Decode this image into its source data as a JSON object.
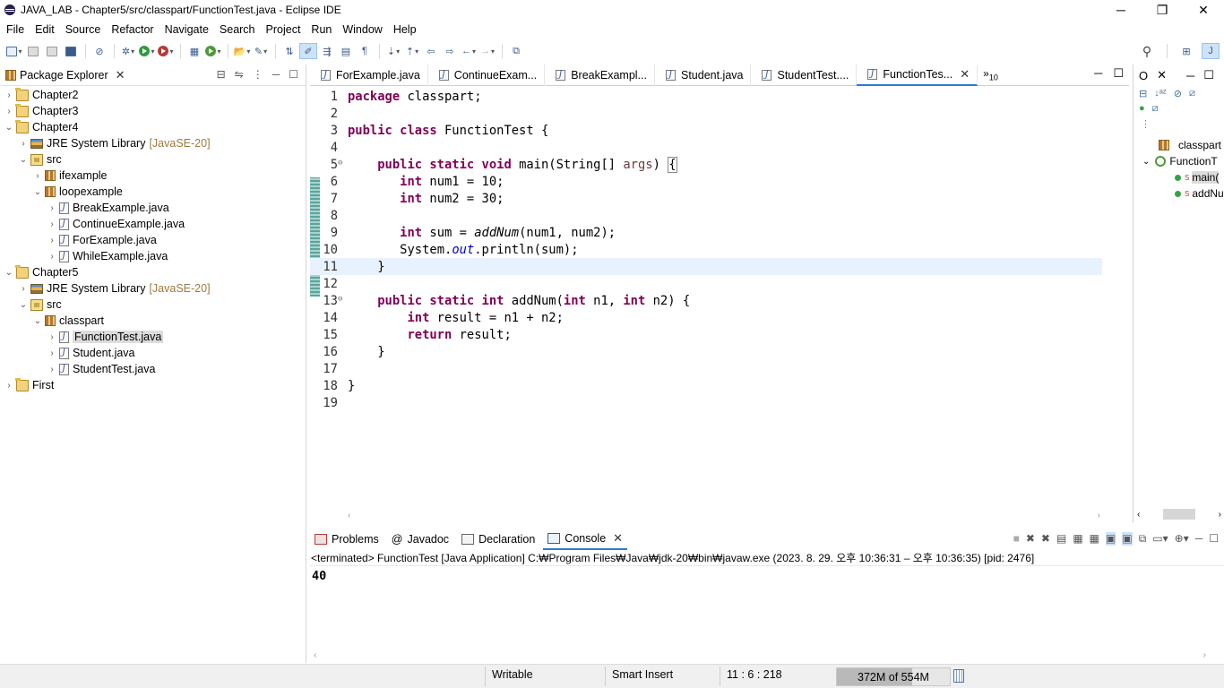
{
  "window": {
    "title": "JAVA_LAB - Chapter5/src/classpart/FunctionTest.java - Eclipse IDE",
    "minimize": "─",
    "restore": "❐",
    "close": "✕"
  },
  "menu": [
    "File",
    "Edit",
    "Source",
    "Refactor",
    "Navigate",
    "Search",
    "Project",
    "Run",
    "Window",
    "Help"
  ],
  "package_explorer": {
    "title": "Package Explorer",
    "tree": {
      "chapter2": "Chapter2",
      "chapter3": "Chapter3",
      "chapter4": "Chapter4",
      "ch4_jre": "JRE System Library",
      "ch4_jre_ver": "[JavaSE-20]",
      "ch4_src": "src",
      "ifexample": "ifexample",
      "loopexample": "loopexample",
      "break": "BreakExample.java",
      "continue": "ContinueExample.java",
      "for": "ForExample.java",
      "while": "WhileExample.java",
      "chapter5": "Chapter5",
      "ch5_jre": "JRE System Library",
      "ch5_jre_ver": "[JavaSE-20]",
      "ch5_src": "src",
      "classpart": "classpart",
      "functiontest": "FunctionTest.java",
      "student": "Student.java",
      "studenttest": "StudentTest.java",
      "first": "First"
    }
  },
  "editor": {
    "tabs": [
      "ForExample.java",
      "ContinueExam...",
      "BreakExampl...",
      "Student.java",
      "StudentTest....",
      "FunctionTes..."
    ],
    "more_tabs": "»",
    "more_count": "10",
    "line_numbers": [
      "1",
      "2",
      "3",
      "4",
      "5",
      "6",
      "7",
      "8",
      "9",
      "10",
      "11",
      "12",
      "13",
      "14",
      "15",
      "16",
      "17",
      "18",
      "19"
    ],
    "fold5": "⊖",
    "fold13": "⊖",
    "code": {
      "l1_kw": "package",
      "l1_rest": " classpart;",
      "l3_kw": "public class",
      "l3_rest": " FunctionTest {",
      "l5_indent": "    ",
      "l5_kw": "public static void",
      "l5_a": " main(String[] ",
      "l5_var": "args",
      "l5_b": ") ",
      "l5_brace": "{",
      "l6_indent": "       ",
      "l6_kw": "int",
      "l6_rest": " num1 = 10;",
      "l7_indent": "       ",
      "l7_kw": "int",
      "l7_rest": " num2 = 30;",
      "l9_indent": "       ",
      "l9_kw": "int",
      "l9_a": " sum = ",
      "l9_m": "addNum",
      "l9_b": "(num1, num2);",
      "l10_indent": "       ",
      "l10_a": "System.",
      "l10_f": "out",
      "l10_b": ".println(sum);",
      "l11": "    }",
      "l13_indent": "    ",
      "l13_kw": "public static int",
      "l13_a": " addNum(",
      "l13_kw2": "int",
      "l13_b": " n1, ",
      "l13_kw3": "int",
      "l13_c": " n2) {",
      "l14_indent": "        ",
      "l14_kw": "int",
      "l14_rest": " result = n1 + n2;",
      "l15_indent": "        ",
      "l15_kw": "return",
      "l15_rest": " result;",
      "l16": "    }",
      "l18": "}"
    }
  },
  "outline": {
    "tab1": "O",
    "tab2": "✕",
    "classpart": "classpart",
    "function_class": "FunctionT",
    "main": "main(",
    "addnum": "addNu",
    "static_marker": "S"
  },
  "console": {
    "tabs": [
      "Problems",
      "Javadoc",
      "Declaration",
      "Console"
    ],
    "javadoc_at": "@",
    "info": "<terminated> FunctionTest [Java Application] C:₩Program Files₩Java₩jdk-20₩bin₩javaw.exe  (2023. 8. 29. 오후 10:36:31 – 오후 10:36:35) [pid: 2476]",
    "output": "40"
  },
  "status": {
    "writable": "Writable",
    "insert_mode": "Smart Insert",
    "position": "11 : 6 : 218",
    "heap": "372M of 554M",
    "heap_used_fraction": 0.67
  },
  "colors": {
    "keyword": "#7f0055",
    "field": "#0000c0",
    "accent": "#2a7ad8"
  }
}
